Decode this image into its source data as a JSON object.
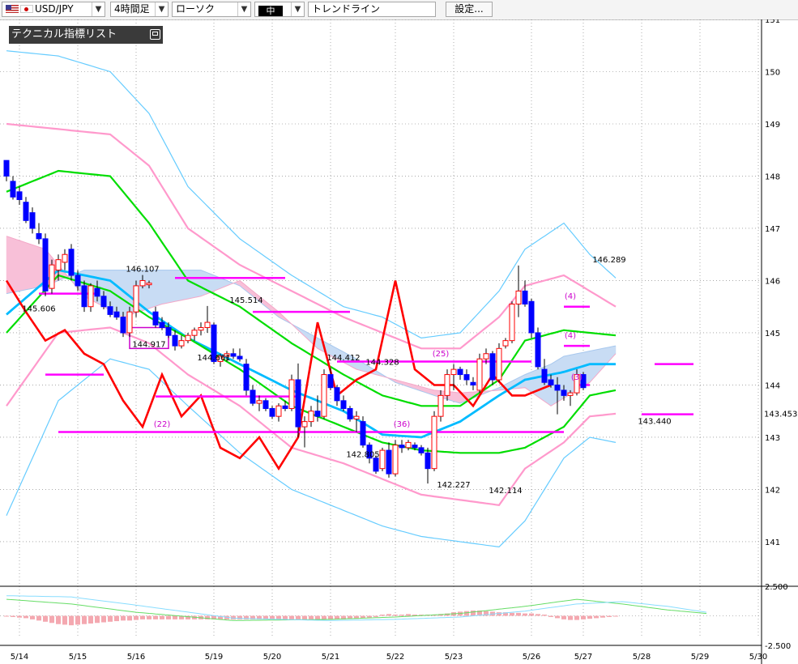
{
  "toolbar": {
    "symbol": "USD/JPY",
    "timeframe": "4時間足",
    "chart_type": "ローソク",
    "line_width": "中",
    "tool": "トレンドライン",
    "settings": "設定..."
  },
  "indicator_panel": {
    "title": "テクニカル指標リスト"
  },
  "colors": {
    "up_candle": "#ff0000",
    "down_candle": "#0000ff",
    "cloud_bull": "#c8dcf4",
    "cloud_bear": "#f8c0d8",
    "sma_green": "#00dd00",
    "ema_blue": "#00bbff",
    "bb_outer": "#66ccff",
    "bb_inner": "#ff99cc",
    "lagging_red": "#ff0000",
    "hline_magenta": "#ff00ff"
  },
  "chart_data": {
    "type": "candlestick",
    "symbol": "USD/JPY",
    "timeframe": "4時間足",
    "ylim": [
      140.1,
      151.0
    ],
    "y_ticks": [
      151,
      150,
      149,
      148,
      147,
      146,
      145,
      144,
      143,
      142,
      141
    ],
    "y_tick_labels": [
      "151",
      "150",
      "149",
      "148",
      "147",
      "146",
      "145",
      "144",
      "143",
      "142",
      "141"
    ],
    "current_price": "143.453",
    "x_labels": [
      "5/14",
      "5/15",
      "5/16",
      "5/19",
      "5/20",
      "5/21",
      "5/22",
      "5/23",
      "5/26",
      "5/27",
      "5/28",
      "5/29",
      "5/30"
    ],
    "x_label_candle_index": [
      2,
      11,
      20,
      32,
      41,
      50,
      60,
      69,
      81,
      89,
      98,
      107,
      116
    ],
    "candles": [
      [
        148.3,
        148.25,
        147.9,
        148.0
      ],
      [
        147.9,
        148.0,
        147.55,
        147.6
      ],
      [
        147.7,
        147.8,
        147.45,
        147.55
      ],
      [
        147.5,
        147.6,
        147.1,
        147.15
      ],
      [
        147.3,
        147.4,
        146.9,
        147.0
      ],
      [
        146.9,
        147.1,
        146.7,
        146.8
      ],
      [
        146.8,
        146.9,
        145.7,
        145.8
      ],
      [
        145.85,
        146.4,
        145.75,
        146.3
      ],
      [
        146.2,
        146.5,
        146.0,
        146.4
      ],
      [
        146.35,
        146.6,
        146.2,
        146.5
      ],
      [
        146.6,
        146.7,
        146.0,
        146.1
      ],
      [
        146.1,
        146.2,
        145.8,
        145.9
      ],
      [
        145.9,
        146.0,
        145.4,
        145.5
      ],
      [
        145.5,
        145.95,
        145.4,
        145.9
      ],
      [
        145.85,
        146.0,
        145.6,
        145.7
      ],
      [
        145.7,
        145.8,
        145.45,
        145.5
      ],
      [
        145.5,
        145.6,
        145.3,
        145.35
      ],
      [
        145.4,
        145.5,
        145.25,
        145.3
      ],
      [
        145.3,
        145.4,
        144.92,
        145.0
      ],
      [
        145.0,
        145.5,
        144.92,
        145.4
      ],
      [
        145.4,
        146.0,
        145.3,
        145.9
      ],
      [
        145.9,
        146.107,
        145.85,
        146.0
      ],
      [
        145.92,
        146.0,
        145.85,
        145.95
      ],
      [
        145.4,
        145.5,
        145.1,
        145.15
      ],
      [
        145.2,
        145.3,
        145.05,
        145.1
      ],
      [
        145.1,
        145.2,
        144.9,
        144.95
      ],
      [
        144.95,
        145.05,
        144.66,
        144.75
      ],
      [
        144.75,
        144.95,
        144.7,
        144.85
      ],
      [
        144.85,
        145.0,
        144.8,
        144.95
      ],
      [
        144.95,
        145.1,
        144.85,
        145.05
      ],
      [
        145.05,
        145.2,
        144.95,
        145.1
      ],
      [
        145.1,
        145.514,
        145.0,
        145.2
      ],
      [
        145.15,
        145.2,
        144.4,
        144.45
      ],
      [
        144.45,
        144.6,
        144.35,
        144.55
      ],
      [
        144.55,
        144.65,
        144.45,
        144.6
      ],
      [
        144.6,
        144.7,
        144.5,
        144.55
      ],
      [
        144.55,
        144.7,
        144.45,
        144.5
      ],
      [
        144.4,
        144.5,
        143.8,
        143.9
      ],
      [
        143.9,
        144.0,
        143.6,
        143.65
      ],
      [
        143.65,
        143.8,
        143.5,
        143.7
      ],
      [
        143.7,
        143.75,
        143.5,
        143.55
      ],
      [
        143.55,
        143.6,
        143.35,
        143.4
      ],
      [
        143.4,
        143.65,
        143.3,
        143.6
      ],
      [
        143.6,
        143.7,
        143.5,
        143.55
      ],
      [
        143.55,
        144.2,
        143.5,
        144.1
      ],
      [
        144.1,
        144.412,
        143.0,
        143.2
      ],
      [
        143.2,
        143.4,
        142.805,
        143.3
      ],
      [
        143.3,
        143.6,
        143.2,
        143.5
      ],
      [
        143.5,
        143.8,
        143.3,
        143.4
      ],
      [
        143.4,
        144.3,
        143.35,
        144.2
      ],
      [
        144.2,
        144.328,
        143.9,
        143.95
      ],
      [
        143.95,
        144.0,
        143.6,
        143.7
      ],
      [
        143.7,
        143.8,
        143.5,
        143.55
      ],
      [
        143.55,
        143.6,
        143.3,
        143.35
      ],
      [
        143.35,
        143.5,
        143.1,
        143.4
      ],
      [
        143.3,
        143.4,
        142.8,
        142.85
      ],
      [
        142.85,
        142.9,
        142.5,
        142.6
      ],
      [
        142.6,
        142.65,
        142.3,
        142.35
      ],
      [
        142.4,
        142.8,
        142.35,
        142.75
      ],
      [
        142.75,
        142.9,
        142.227,
        142.3
      ],
      [
        142.3,
        142.95,
        142.25,
        142.85
      ],
      [
        142.85,
        142.95,
        142.7,
        142.8
      ],
      [
        142.8,
        142.95,
        142.75,
        142.9
      ],
      [
        142.85,
        142.9,
        142.75,
        142.8
      ],
      [
        142.8,
        142.85,
        142.65,
        142.7
      ],
      [
        142.7,
        142.8,
        142.114,
        142.4
      ],
      [
        142.4,
        143.5,
        142.35,
        143.4
      ],
      [
        143.4,
        143.9,
        143.3,
        143.8
      ],
      [
        143.8,
        144.3,
        143.7,
        144.2
      ],
      [
        144.2,
        144.4,
        143.9,
        144.3
      ],
      [
        144.3,
        144.35,
        144.1,
        144.2
      ],
      [
        144.2,
        144.3,
        144.0,
        144.1
      ],
      [
        144.05,
        144.15,
        143.9,
        144.0
      ],
      [
        143.9,
        144.6,
        143.85,
        144.5
      ],
      [
        144.5,
        144.7,
        144.4,
        144.6
      ],
      [
        144.6,
        144.65,
        144.0,
        144.1
      ],
      [
        144.1,
        144.8,
        144.05,
        144.7
      ],
      [
        144.75,
        144.9,
        144.7,
        144.85
      ],
      [
        144.85,
        145.6,
        144.8,
        145.55
      ],
      [
        145.55,
        146.289,
        145.3,
        145.8
      ],
      [
        145.8,
        146.0,
        145.5,
        145.55
      ],
      [
        145.6,
        145.65,
        144.9,
        145.0
      ],
      [
        145.0,
        145.1,
        144.3,
        144.35
      ],
      [
        144.3,
        144.5,
        144.0,
        144.05
      ],
      [
        144.1,
        144.2,
        143.95,
        144.0
      ],
      [
        144.0,
        144.15,
        143.44,
        143.9
      ],
      [
        143.9,
        144.0,
        143.7,
        143.8
      ],
      [
        143.8,
        143.9,
        143.6,
        143.85
      ],
      [
        143.85,
        144.3,
        143.8,
        144.2
      ],
      [
        144.2,
        144.25,
        143.9,
        143.95
      ]
    ],
    "series": [
      {
        "name": "",
        "kind": "bb_upper2",
        "x": [
          0,
          8,
          16,
          22,
          28,
          36,
          44,
          52,
          58,
          64,
          70,
          76,
          80,
          86,
          90,
          94
        ],
        "values": [
          150.4,
          150.3,
          150.0,
          149.2,
          147.8,
          146.8,
          146.1,
          145.5,
          145.3,
          144.9,
          145.0,
          145.8,
          146.6,
          147.1,
          146.5,
          146.05
        ]
      },
      {
        "name": "",
        "kind": "bb_upper1",
        "x": [
          0,
          8,
          16,
          22,
          28,
          36,
          44,
          52,
          58,
          64,
          70,
          76,
          80,
          86,
          90,
          94
        ],
        "values": [
          149.0,
          148.9,
          148.8,
          148.2,
          147.0,
          146.3,
          145.8,
          145.3,
          145.0,
          144.7,
          144.7,
          145.3,
          145.9,
          146.1,
          145.8,
          145.5
        ]
      },
      {
        "name": "",
        "kind": "sma",
        "x": [
          0,
          8,
          16,
          22,
          28,
          36,
          44,
          52,
          58,
          64,
          70,
          76,
          80,
          86,
          90,
          94
        ],
        "values": [
          147.7,
          148.1,
          148.0,
          147.1,
          146.0,
          145.5,
          144.8,
          144.2,
          143.8,
          143.6,
          143.6,
          144.1,
          144.85,
          145.05,
          145.0,
          144.95
        ]
      },
      {
        "name": "",
        "kind": "ema",
        "x": [
          0,
          8,
          16,
          22,
          28,
          36,
          44,
          52,
          58,
          64,
          70,
          76,
          80,
          86,
          90,
          94
        ],
        "values": [
          145.35,
          146.2,
          146.0,
          145.4,
          144.9,
          144.4,
          143.9,
          143.5,
          143.05,
          143.0,
          143.3,
          143.8,
          144.1,
          144.25,
          144.4,
          144.4
        ]
      },
      {
        "name": "",
        "kind": "sma_short",
        "x": [
          0,
          8,
          16,
          22,
          28,
          36,
          44,
          52,
          58,
          64,
          70,
          76,
          80,
          86,
          90,
          94
        ],
        "values": [
          145.0,
          146.1,
          145.8,
          145.3,
          144.9,
          144.3,
          143.6,
          143.2,
          142.9,
          142.75,
          142.7,
          142.7,
          142.8,
          143.2,
          143.8,
          143.9
        ]
      },
      {
        "name": "",
        "kind": "bb_lower1",
        "x": [
          0,
          8,
          16,
          22,
          28,
          36,
          44,
          52,
          58,
          64,
          70,
          76,
          80,
          86,
          90,
          94
        ],
        "values": [
          143.6,
          145.0,
          145.1,
          144.8,
          144.2,
          143.6,
          142.8,
          142.5,
          142.2,
          141.9,
          141.8,
          141.7,
          142.4,
          142.9,
          143.4,
          143.45
        ]
      },
      {
        "name": "",
        "kind": "bb_lower2",
        "x": [
          0,
          8,
          16,
          22,
          28,
          36,
          44,
          52,
          58,
          64,
          70,
          76,
          80,
          86,
          90,
          94
        ],
        "values": [
          141.5,
          143.7,
          144.5,
          144.3,
          143.6,
          142.7,
          142.0,
          141.6,
          141.3,
          141.1,
          141.0,
          140.9,
          141.4,
          142.6,
          143.0,
          142.9
        ]
      },
      {
        "name": "",
        "kind": "lagging",
        "x": [
          0,
          3,
          6,
          9,
          12,
          15,
          18,
          21,
          24,
          27,
          30,
          33,
          36,
          39,
          42,
          45,
          48,
          51,
          54,
          57,
          60,
          63,
          66,
          69,
          72,
          75,
          78,
          80,
          84
        ],
        "values": [
          146.0,
          145.4,
          144.85,
          145.05,
          144.6,
          144.4,
          143.7,
          143.2,
          144.2,
          143.4,
          143.8,
          142.8,
          142.6,
          143.0,
          142.4,
          143.0,
          145.2,
          143.8,
          144.1,
          144.3,
          146.0,
          144.3,
          144.0,
          144.0,
          143.6,
          144.2,
          143.8,
          143.8,
          144.0
        ]
      }
    ],
    "cloud_x": [
      0,
      6,
      12,
      18,
      24,
      30,
      36,
      42,
      48,
      54,
      60,
      66,
      70,
      76,
      80,
      84,
      86,
      90,
      94
    ],
    "cloud_a": [
      145.75,
      145.9,
      146.2,
      146.2,
      146.2,
      146.2,
      145.9,
      145.3,
      144.9,
      144.5,
      144.05,
      143.8,
      143.65,
      143.95,
      144.2,
      144.4,
      144.55,
      144.65,
      144.75
    ],
    "cloud_b": [
      146.85,
      146.6,
      145.7,
      145.3,
      145.55,
      145.7,
      146.0,
      145.4,
      144.7,
      144.3,
      144.1,
      143.9,
      143.85,
      143.9,
      143.95,
      143.6,
      143.75,
      144.05,
      144.6
    ],
    "hlines": [
      {
        "y": 145.75,
        "x0": 5,
        "x1": 14
      },
      {
        "y": 146.05,
        "x0": 26,
        "x1": 43
      },
      {
        "y": 145.4,
        "x0": 38,
        "x1": 53
      },
      {
        "y": 144.2,
        "x0": 6,
        "x1": 15
      },
      {
        "y": 144.45,
        "x0": 51,
        "x1": 81
      },
      {
        "y": 143.78,
        "x0": 23,
        "x1": 32
      },
      {
        "y": 143.78,
        "x0": 30,
        "x1": 45
      },
      {
        "y": 143.1,
        "x0": 8,
        "x1": 86
      },
      {
        "y": 145.5,
        "x0": 86,
        "x1": 90
      },
      {
        "y": 144.75,
        "x0": 86,
        "x1": 90
      },
      {
        "y": 144.0,
        "x0": 88,
        "x1": 90
      },
      {
        "y": 144.4,
        "x0": 100,
        "x1": 106
      },
      {
        "y": 143.44,
        "x0": 98,
        "x1": 106
      }
    ],
    "box": {
      "x0": 19,
      "x1": 25,
      "y0": 145.1,
      "y1": 144.7
    },
    "annotations": [
      {
        "text": "146.107",
        "x": 21,
        "y": 146.107,
        "pos": "above"
      },
      {
        "text": "145.606",
        "x": 5,
        "y": 145.6,
        "pos": "below"
      },
      {
        "text": "144.917",
        "x": 22,
        "y": 144.917,
        "pos": "below"
      },
      {
        "text": "145.514",
        "x": 37,
        "y": 145.514,
        "pos": "above"
      },
      {
        "text": "144.661",
        "x": 32,
        "y": 144.661,
        "pos": "below"
      },
      {
        "text": "144.412",
        "x": 52,
        "y": 144.412,
        "pos": "above"
      },
      {
        "text": "144.328",
        "x": 58,
        "y": 144.328,
        "pos": "above"
      },
      {
        "text": "142.805",
        "x": 55,
        "y": 142.805,
        "pos": "below"
      },
      {
        "text": "142.227",
        "x": 69,
        "y": 142.227,
        "pos": "below"
      },
      {
        "text": "142.114",
        "x": 77,
        "y": 142.114,
        "pos": "below"
      },
      {
        "text": "146.289",
        "x": 93,
        "y": 146.289,
        "pos": "above"
      },
      {
        "text": "143.440",
        "x": 100,
        "y": 143.44,
        "pos": "below"
      }
    ],
    "counts": [
      {
        "text": "(22)",
        "x": 24,
        "y": 143.2
      },
      {
        "text": "(36)",
        "x": 61,
        "y": 143.2
      },
      {
        "text": "(25)",
        "x": 67,
        "y": 144.55
      },
      {
        "text": "(4)",
        "x": 87,
        "y": 145.65
      },
      {
        "text": "(4)",
        "x": 87,
        "y": 144.9
      },
      {
        "text": "(3)",
        "x": 88,
        "y": 144.1
      }
    ],
    "macd": {
      "ylim": [
        -2.5,
        2.5
      ],
      "y_tick_labels": [
        "2.500",
        "-2.500"
      ],
      "histogram": [
        -0.05,
        -0.1,
        -0.15,
        -0.2,
        -0.3,
        -0.4,
        -0.5,
        -0.6,
        -0.7,
        -0.75,
        -0.8,
        -0.75,
        -0.7,
        -0.65,
        -0.6,
        -0.55,
        -0.5,
        -0.45,
        -0.4,
        -0.4,
        -0.35,
        -0.3,
        -0.3,
        -0.3,
        -0.3,
        -0.3,
        -0.3,
        -0.3,
        -0.3,
        -0.3,
        -0.3,
        -0.3,
        -0.3,
        -0.3,
        -0.3,
        -0.3,
        -0.3,
        -0.3,
        -0.3,
        -0.3,
        -0.3,
        -0.3,
        -0.3,
        -0.3,
        -0.3,
        -0.3,
        -0.3,
        -0.3,
        -0.3,
        -0.3,
        -0.3,
        -0.3,
        -0.3,
        -0.25,
        -0.25,
        -0.2,
        -0.15,
        -0.1,
        0.1,
        0.15,
        0.1,
        0.1,
        0.15,
        0.1,
        0.1,
        0.1,
        0.1,
        0.15,
        0.2,
        0.3,
        0.35,
        0.4,
        0.45,
        0.45,
        0.4,
        0.35,
        0.3,
        0.3,
        0.25,
        0.25,
        0.2,
        0.2,
        0.15,
        0.1,
        -0.1,
        -0.2,
        -0.3,
        -0.35,
        -0.35,
        -0.3,
        -0.25,
        -0.2,
        -0.15,
        -0.1,
        -0.05
      ],
      "line1_x": [
        0,
        10,
        20,
        35,
        50,
        60,
        70,
        80,
        88,
        95,
        102,
        108
      ],
      "line1": [
        1.4,
        1.0,
        0.3,
        -0.4,
        -0.3,
        -0.1,
        0.2,
        0.8,
        1.4,
        1.0,
        0.5,
        0.2
      ],
      "line2_x": [
        0,
        10,
        20,
        35,
        50,
        60,
        70,
        80,
        88,
        95,
        102,
        108
      ],
      "line2": [
        1.7,
        1.6,
        0.9,
        -0.2,
        -0.4,
        -0.3,
        -0.1,
        0.4,
        1.0,
        1.2,
        0.8,
        0.3
      ]
    }
  }
}
